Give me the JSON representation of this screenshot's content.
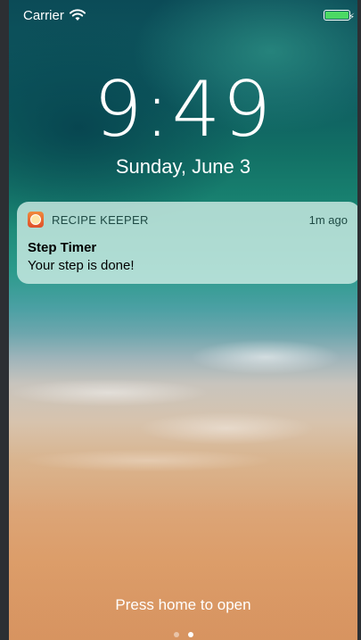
{
  "status_bar": {
    "carrier": "Carrier",
    "wifi_icon": "wifi-icon",
    "battery_icon": "battery-icon",
    "battery_level": 1.0,
    "battery_color": "#4cd964"
  },
  "lock_screen": {
    "time": "9:49",
    "date": "Sunday, June 3"
  },
  "notification": {
    "app_icon": "recipe-keeper-app-icon",
    "app_name": "RECIPE KEEPER",
    "time_ago": "1m ago",
    "title": "Step Timer",
    "body": "Your step is done!"
  },
  "footer": {
    "hint": "Press home to open",
    "page_count": 2,
    "active_page": 2
  }
}
